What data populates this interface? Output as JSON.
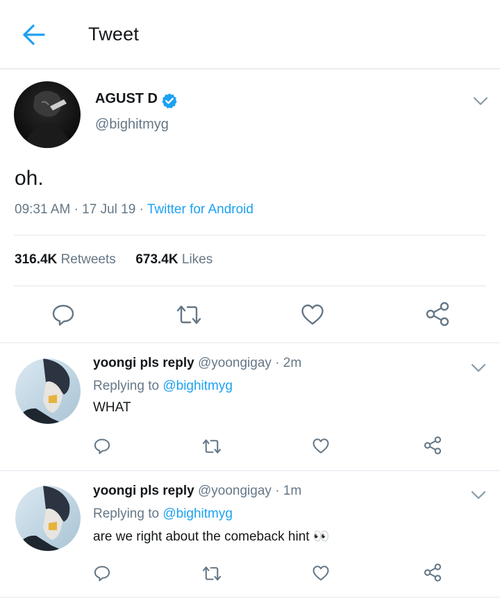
{
  "header": {
    "title": "Tweet"
  },
  "tweet": {
    "author_name": "AGUST D",
    "handle": "@bighitmyg",
    "text": "oh.",
    "time": "09:31 AM",
    "date": "17 Jul 19",
    "separator": "·",
    "source": "Twitter for Android",
    "retweets_count": "316.4K",
    "retweets_label": "Retweets",
    "likes_count": "673.4K",
    "likes_label": "Likes"
  },
  "replies": [
    {
      "name": "yoongi pls reply",
      "handle": "@yoongigay",
      "time": "2m",
      "replying_prefix": "Replying to",
      "replying_to": "@bighitmyg",
      "text": "WHAT"
    },
    {
      "name": "yoongi pls reply",
      "handle": "@yoongigay",
      "time": "1m",
      "replying_prefix": "Replying to",
      "replying_to": "@bighitmyg",
      "text": "are we right about the comeback hint 👀"
    }
  ],
  "colors": {
    "accent": "#1da1f2",
    "text_primary": "#14171a",
    "text_secondary": "#657786",
    "divider": "#e1e8ed",
    "action_icon": "#657786"
  },
  "icons": {
    "back": "arrow-left-icon",
    "verified": "verified-badge-icon",
    "caret": "chevron-down-icon",
    "reply": "reply-bubble-icon",
    "retweet": "retweet-icon",
    "like": "heart-icon",
    "share": "share-icon"
  }
}
